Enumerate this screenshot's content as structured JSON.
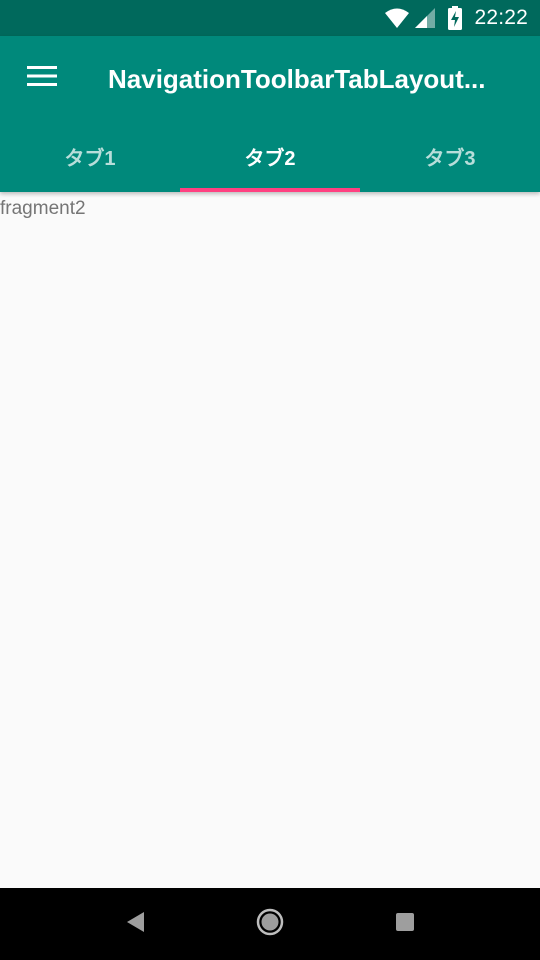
{
  "status_bar": {
    "time": "22:22",
    "icons": [
      "wifi-icon",
      "cell-signal-icon",
      "battery-charging-icon"
    ]
  },
  "toolbar": {
    "menu_icon": "hamburger-menu-icon",
    "title": "NavigationToolbarTabLayout..."
  },
  "tabs": [
    {
      "label": "タブ1",
      "selected": false
    },
    {
      "label": "タブ2",
      "selected": true
    },
    {
      "label": "タブ3",
      "selected": false
    }
  ],
  "content": {
    "text": "fragment2"
  },
  "nav_bar": {
    "icons": [
      "back-icon",
      "home-icon",
      "recents-icon"
    ]
  },
  "colors": {
    "status_bar": "#00695c",
    "primary": "#00897b",
    "accent": "#ff4081",
    "background": "#fafafa",
    "nav_bar": "#000000"
  }
}
